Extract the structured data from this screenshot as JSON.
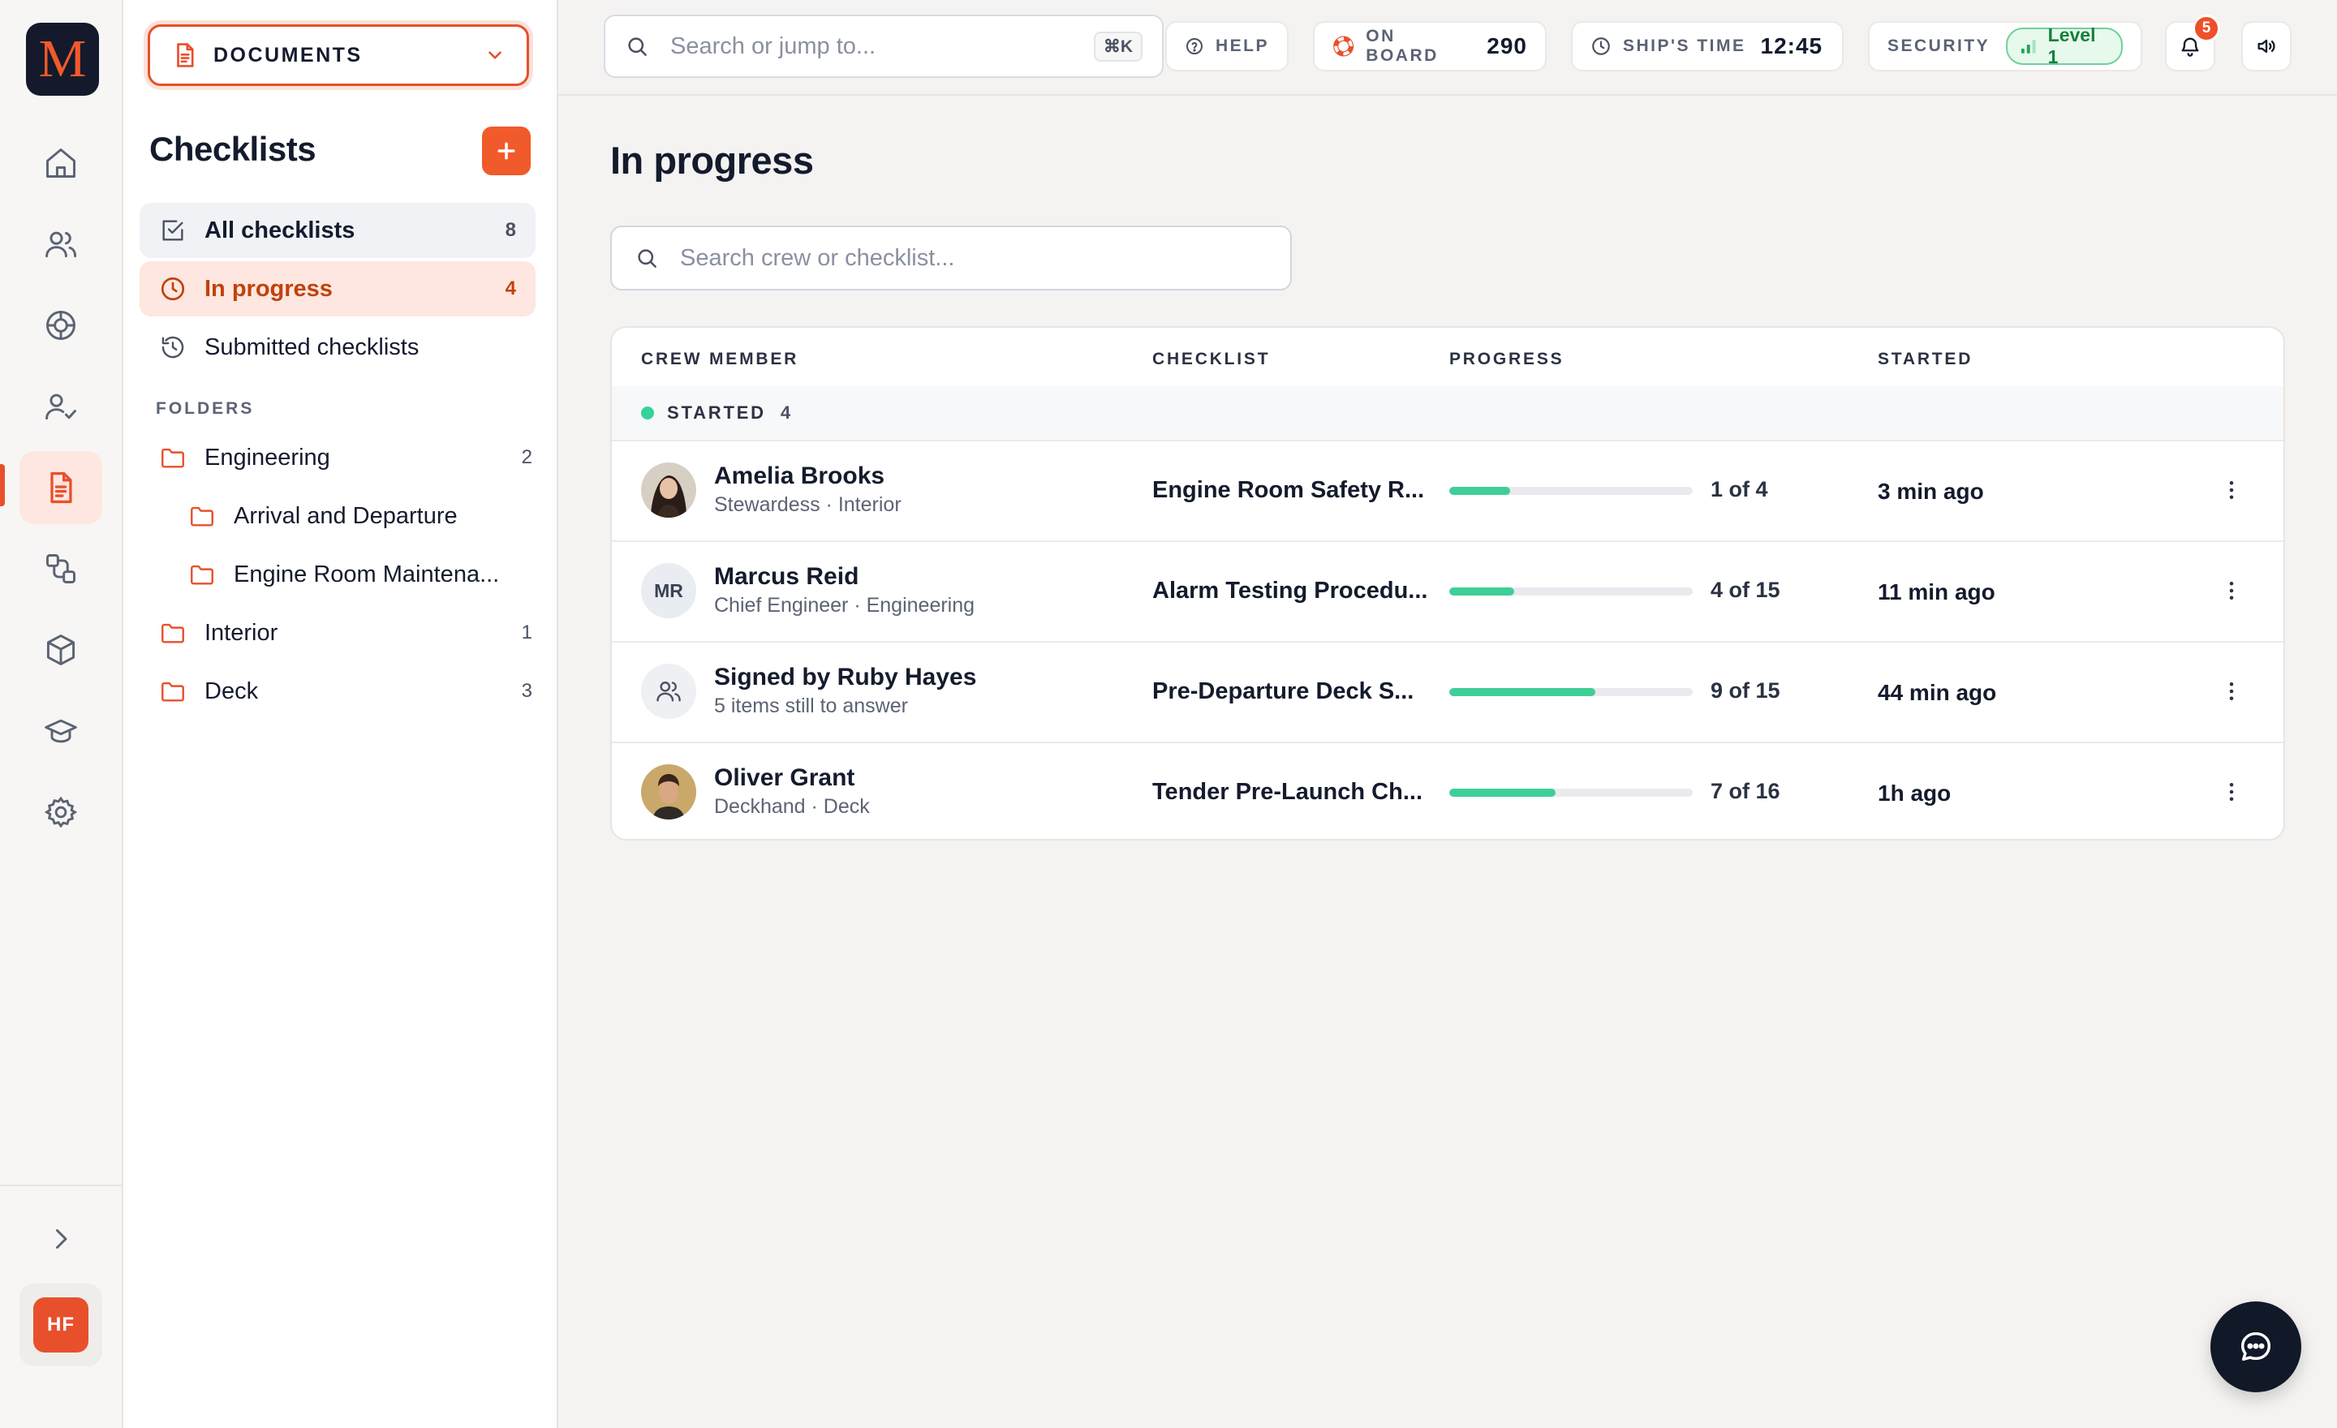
{
  "app": {
    "logo_letter": "M",
    "brand_color": "#e8502c"
  },
  "rail": {
    "items": [
      {
        "icon": "home-icon"
      },
      {
        "icon": "users-icon"
      },
      {
        "icon": "lifebuoy-icon"
      },
      {
        "icon": "user-check-icon"
      },
      {
        "icon": "documents-icon",
        "active": true
      },
      {
        "icon": "workflow-icon"
      },
      {
        "icon": "package-icon"
      },
      {
        "icon": "graduation-cap-icon"
      },
      {
        "icon": "settings-icon"
      }
    ],
    "expand_icon": "chevron-right-icon",
    "user_initials": "HF"
  },
  "sidebar": {
    "module_select": "DOCUMENTS",
    "title": "Checklists",
    "nav": [
      {
        "label": "All checklists",
        "count": "8"
      },
      {
        "label": "In progress",
        "count": "4"
      },
      {
        "label": "Submitted checklists",
        "count": ""
      }
    ],
    "folders_heading": "FOLDERS",
    "folders": [
      {
        "label": "Engineering",
        "count": "2"
      },
      {
        "label": "Arrival and Departure",
        "count": ""
      },
      {
        "label": "Engine Room Maintena...",
        "count": ""
      },
      {
        "label": "Interior",
        "count": "1"
      },
      {
        "label": "Deck",
        "count": "3"
      }
    ]
  },
  "topbar": {
    "search_placeholder": "Search or jump to...",
    "shortcut": "⌘K",
    "help_label": "HELP",
    "on_board_label": "ON BOARD",
    "on_board_value": "290",
    "ship_time_label": "SHIP'S TIME",
    "ship_time_value": "12:45",
    "security_label": "SECURITY",
    "security_level": "Level 1",
    "notifications_count": "5"
  },
  "main": {
    "title": "In progress",
    "search_placeholder": "Search crew or checklist...",
    "columns": [
      "CREW MEMBER",
      "CHECKLIST",
      "PROGRESS",
      "STARTED"
    ],
    "group_label": "STARTED",
    "group_count": "4",
    "rows": [
      {
        "name": "Amelia Brooks",
        "sub": "Stewardess · Interior",
        "checklist": "Engine Room Safety R...",
        "done": 1,
        "total": 4,
        "progress": "1 of 4",
        "started": "3 min ago",
        "avatar": "photo-female"
      },
      {
        "name": "Marcus Reid",
        "sub": "Chief Engineer · Engineering",
        "checklist": "Alarm Testing Procedu...",
        "done": 4,
        "total": 15,
        "progress": "4 of 15",
        "started": "11 min ago",
        "avatar": "MR"
      },
      {
        "name": "Signed by Ruby Hayes",
        "sub": "5 items still to answer",
        "checklist": "Pre-Departure Deck S...",
        "done": 9,
        "total": 15,
        "progress": "9 of 15",
        "started": "44 min ago",
        "avatar": "group-icon"
      },
      {
        "name": "Oliver Grant",
        "sub": "Deckhand · Deck",
        "checklist": "Tender Pre-Launch Ch...",
        "done": 7,
        "total": 16,
        "progress": "7 of 16",
        "started": "1h ago",
        "avatar": "photo-male"
      }
    ]
  },
  "colors": {
    "accent": "#e8502c",
    "progress": "#3ecf97",
    "status_dot": "#34d399",
    "security_green": "#15803d"
  }
}
